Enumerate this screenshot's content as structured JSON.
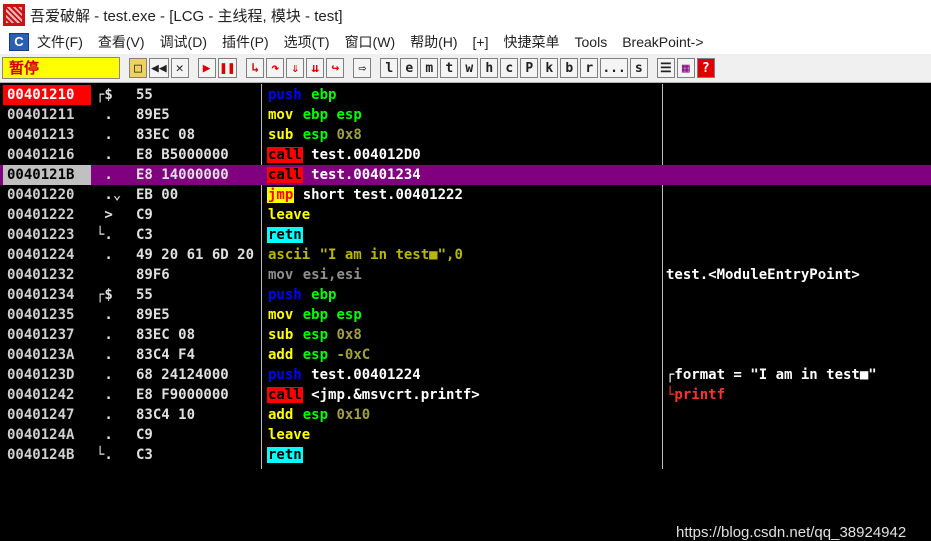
{
  "window": {
    "title": "吾爱破解 - test.exe - [LCG - 主线程, 模块 - test]"
  },
  "menu": {
    "doc_icon": "C",
    "items": [
      "文件(F)",
      "查看(V)",
      "调试(D)",
      "插件(P)",
      "选项(T)",
      "窗口(W)",
      "帮助(H)",
      "[+]",
      "快捷菜单",
      "Tools",
      "BreakPoint->"
    ]
  },
  "toolbar": {
    "status": "暂停",
    "letters": [
      "l",
      "e",
      "m",
      "t",
      "w",
      "h",
      "c",
      "P",
      "k",
      "b",
      "r",
      "...",
      "s"
    ]
  },
  "disasm": {
    "rows": [
      {
        "addr": "00401210",
        "mark": "┌$",
        "hex": "55",
        "mn": "push",
        "ops": " ebp",
        "cmt": ""
      },
      {
        "addr": "00401211",
        "mark": " .",
        "hex": "89E5",
        "mn": "mov",
        "ops": " ebp,esp",
        "cmt": ""
      },
      {
        "addr": "00401213",
        "mark": " .",
        "hex": "83EC 08",
        "mn": "sub",
        "ops": " esp,0x8",
        "cmt": ""
      },
      {
        "addr": "00401216",
        "mark": " .",
        "hex": "E8 B5000000",
        "mn": "call",
        "ops": " test.004012D0",
        "cmt": ""
      },
      {
        "addr": "0040121B",
        "mark": " .",
        "hex": "E8 14000000",
        "mn": "call",
        "ops": " test.00401234",
        "cmt": ""
      },
      {
        "addr": "00401220",
        "mark": " .⌄",
        "hex": "EB 00",
        "mn": "jmp",
        "ops": " short test.00401222",
        "cmt": ""
      },
      {
        "addr": "00401222",
        "mark": " >",
        "hex": "C9",
        "mn": "leave",
        "ops": "",
        "cmt": ""
      },
      {
        "addr": "00401223",
        "mark": "└.",
        "hex": "C3",
        "mn": "retn",
        "ops": "",
        "cmt": ""
      },
      {
        "addr": "00401224",
        "mark": " .",
        "hex": "49 20 61 6D 20",
        "mn": "ascii",
        "ops": " \"I am in test■\",0",
        "cmt": ""
      },
      {
        "addr": "00401232",
        "mark": "",
        "hex": "89F6",
        "mn": "mov",
        "ops": " esi,esi",
        "cmt": "test.<ModuleEntryPoint>"
      },
      {
        "addr": "00401234",
        "mark": "┌$",
        "hex": "55",
        "mn": "push",
        "ops": " ebp",
        "cmt": ""
      },
      {
        "addr": "00401235",
        "mark": " .",
        "hex": "89E5",
        "mn": "mov",
        "ops": " ebp,esp",
        "cmt": ""
      },
      {
        "addr": "00401237",
        "mark": " .",
        "hex": "83EC 08",
        "mn": "sub",
        "ops": " esp,0x8",
        "cmt": ""
      },
      {
        "addr": "0040123A",
        "mark": " .",
        "hex": "83C4 F4",
        "mn": "add",
        "ops": " esp,-0xC",
        "cmt": ""
      },
      {
        "addr": "0040123D",
        "mark": " .",
        "hex": "68 24124000",
        "mn": "push",
        "ops": " test.00401224",
        "cmt": "┌format = \"I am in test■\""
      },
      {
        "addr": "00401242",
        "mark": " .",
        "hex": "E8 F9000000",
        "mn": "call",
        "ops": " <jmp.&msvcrt.printf>",
        "cmt": "└printf"
      },
      {
        "addr": "00401247",
        "mark": " .",
        "hex": "83C4 10",
        "mn": "add",
        "ops": " esp,0x10",
        "cmt": ""
      },
      {
        "addr": "0040124A",
        "mark": " .",
        "hex": "C9",
        "mn": "leave",
        "ops": "",
        "cmt": ""
      },
      {
        "addr": "0040124B",
        "mark": "└.",
        "hex": "C3",
        "mn": "retn",
        "ops": "",
        "cmt": ""
      }
    ],
    "current_addr": "00401210",
    "selected_addr": "0040121B"
  },
  "watermark": "https://blog.csdn.net/qq_38924942"
}
